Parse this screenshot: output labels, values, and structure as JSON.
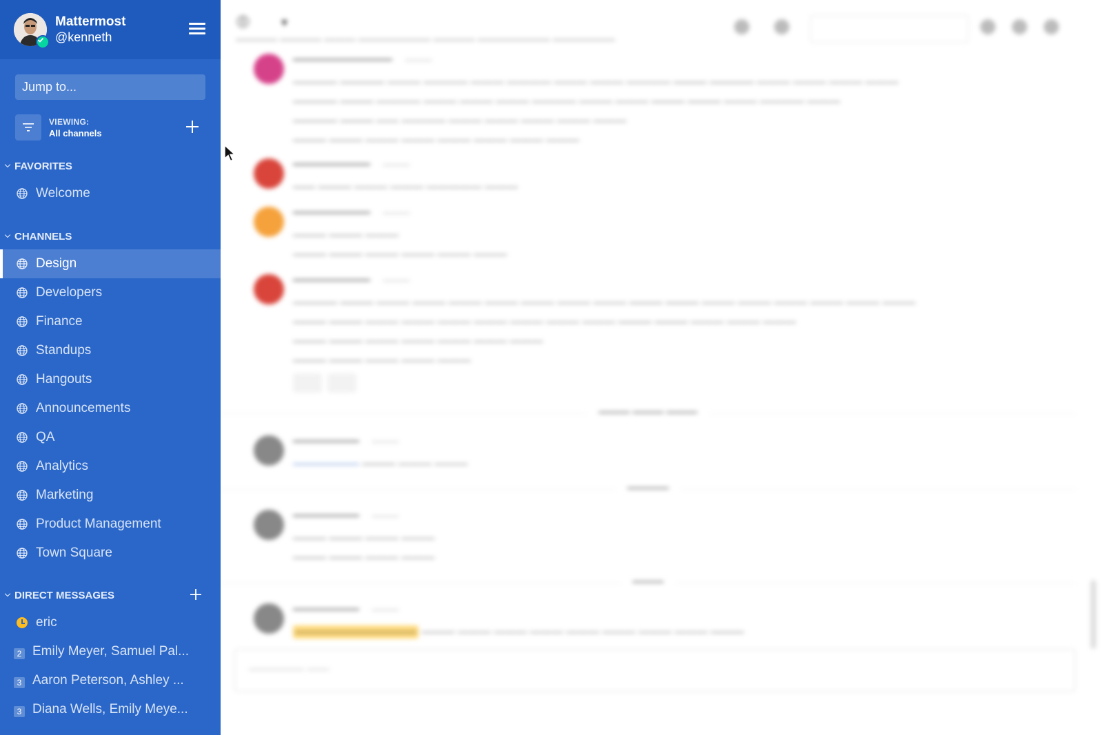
{
  "team": {
    "name": "Mattermost",
    "username": "@kenneth"
  },
  "sidebar": {
    "jump_placeholder": "Jump to...",
    "viewing_label": "VIEWING:",
    "viewing_value": "All channels",
    "favorites_header": "FAVORITES",
    "favorites": [
      {
        "label": "Welcome",
        "icon": "globe-icon"
      }
    ],
    "channels_header": "CHANNELS",
    "channels": [
      {
        "label": "Design",
        "icon": "globe-icon",
        "active": true
      },
      {
        "label": "Developers",
        "icon": "globe-icon"
      },
      {
        "label": "Finance",
        "icon": "globe-icon"
      },
      {
        "label": "Standups",
        "icon": "globe-icon"
      },
      {
        "label": "Hangouts",
        "icon": "globe-icon"
      },
      {
        "label": "Announcements",
        "icon": "globe-icon"
      },
      {
        "label": "QA",
        "icon": "globe-icon"
      },
      {
        "label": "Analytics",
        "icon": "globe-icon"
      },
      {
        "label": "Marketing",
        "icon": "globe-icon"
      },
      {
        "label": "Product Management",
        "icon": "globe-icon"
      },
      {
        "label": "Town Square",
        "icon": "globe-icon"
      }
    ],
    "dm_header": "DIRECT MESSAGES",
    "direct_messages": [
      {
        "label": "eric",
        "icon": "away-clock-icon"
      },
      {
        "label": "Emily Meyer, Samuel Pal...",
        "badge": "2"
      },
      {
        "label": "Aaron Peterson, Ashley ...",
        "badge": "3"
      },
      {
        "label": "Diana Wells, Emily Meye...",
        "badge": "3"
      }
    ]
  },
  "colors": {
    "sidebar_bg": "#2a67c9",
    "sidebar_header_bg": "#1f5bbd",
    "online_status": "#06d6a0",
    "away_status": "#ffbc1f"
  }
}
